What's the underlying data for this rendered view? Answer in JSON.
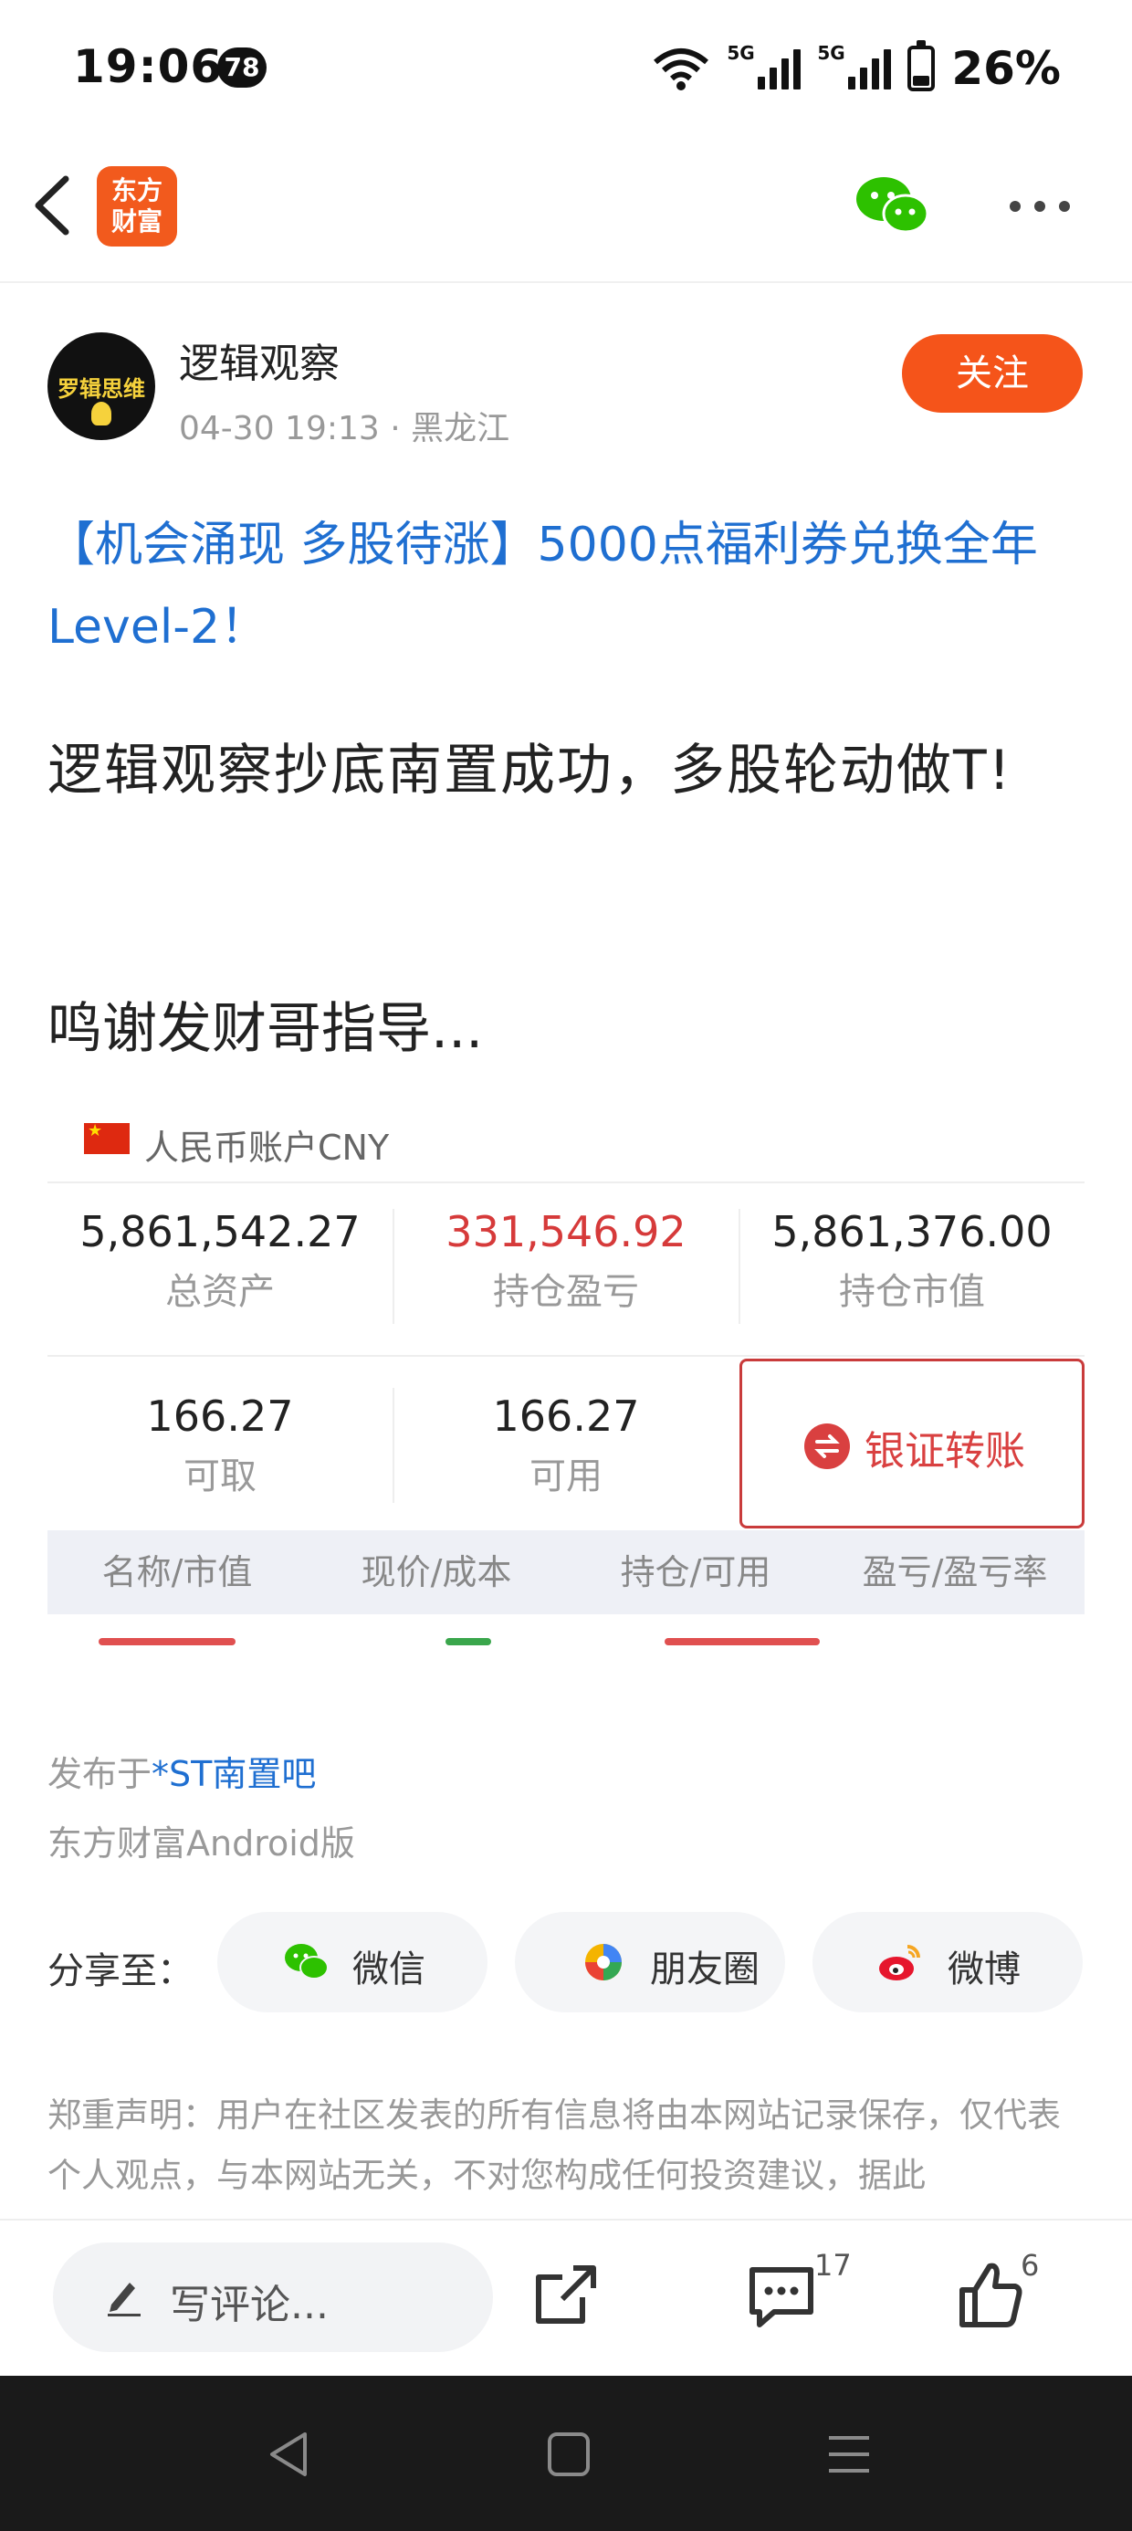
{
  "status_bar": {
    "time": "19:06",
    "notification_count": "78",
    "network_1": "5G",
    "network_2": "5G",
    "battery": "26%"
  },
  "nav": {
    "logo_line1": "东方",
    "logo_line2": "财富"
  },
  "author": {
    "avatar_text": "罗辑思维",
    "name": "逻辑观察",
    "meta": "04-30 19:13 · 黑龙江",
    "follow_label": "关注"
  },
  "post": {
    "title": "【机会涌现 多股待涨】5000点福利券兑换全年Level-2！",
    "body_1": "逻辑观察抄底南置成功，多股轮动做T!",
    "body_2": "鸣谢发财哥指导..."
  },
  "account": {
    "currency": "人民币账户CNY",
    "total_assets": {
      "value": "5,861,542.27",
      "label": "总资产"
    },
    "position_pnl": {
      "value": "331,546.92",
      "label": "持仓盈亏"
    },
    "market_value": {
      "value": "5,861,376.00",
      "label": "持仓市值"
    },
    "withdrawable": {
      "value": "166.27",
      "label": "可取"
    },
    "available": {
      "value": "166.27",
      "label": "可用"
    },
    "transfer_label": "银证转账",
    "table_headers": [
      "名称/市值",
      "现价/成本",
      "持仓/可用",
      "盈亏/盈亏率"
    ]
  },
  "footer": {
    "published_prefix": "发布于",
    "published_bar": "*ST南置吧",
    "client": "东方财富Android版",
    "share_label": "分享至：",
    "share_wechat": "微信",
    "share_moments": "朋友圈",
    "share_weibo": "微博",
    "disclaimer": "郑重声明：用户在社区发表的所有信息将由本网站记录保存，仅代表个人观点，与本网站无关，不对您构成任何投资建议，据此"
  },
  "bottom_bar": {
    "comment_placeholder": "写评论...",
    "comment_count": "17",
    "like_count": "6"
  },
  "colors": {
    "accent_orange": "#f5541a",
    "link_blue": "#1f6fd1",
    "loss_red": "#d63a3a"
  },
  "icons": [
    "back-icon",
    "wechat-icon",
    "more-icon",
    "flag-icon",
    "transfer-icon",
    "moments-icon",
    "weibo-icon",
    "pen-icon",
    "share-icon",
    "comment-icon",
    "like-icon"
  ]
}
